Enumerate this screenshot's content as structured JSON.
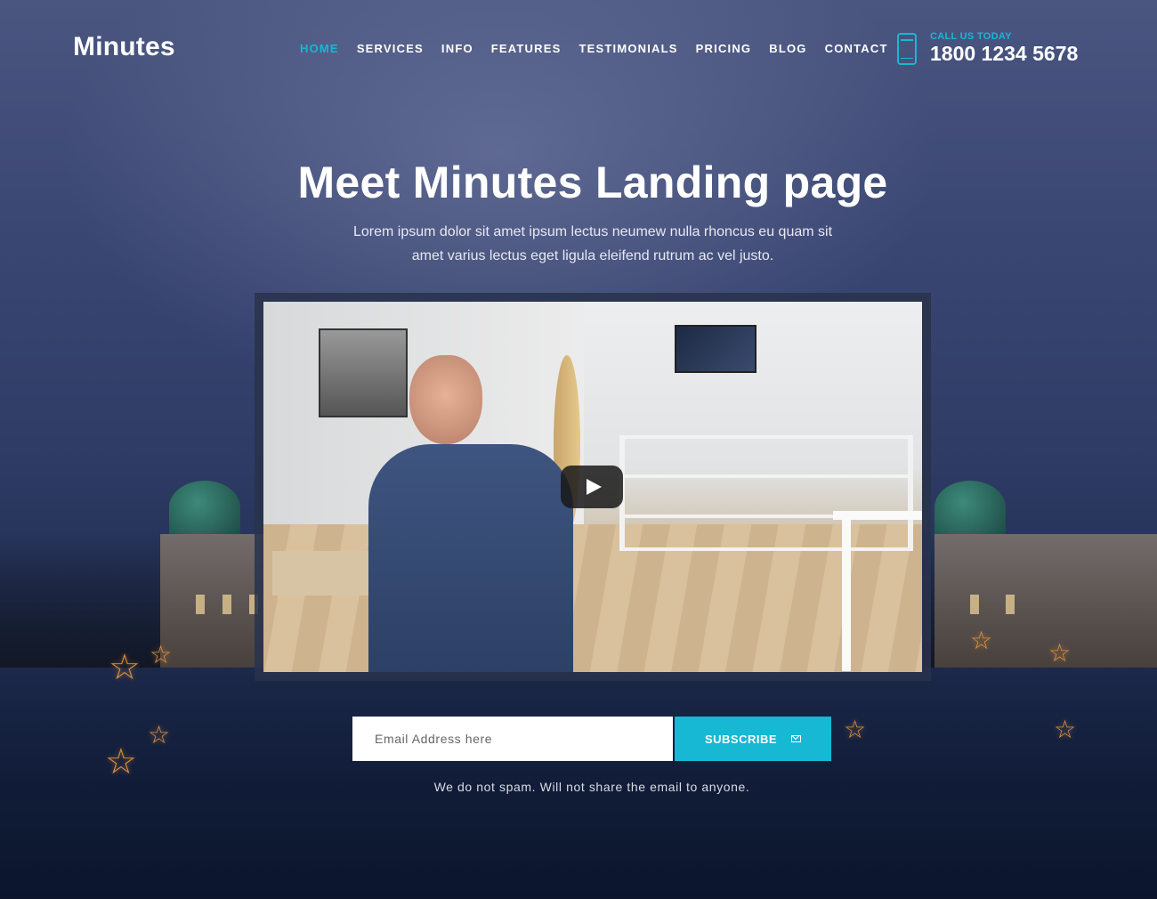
{
  "header": {
    "logo": "Minutes",
    "nav": [
      {
        "label": "HOME",
        "active": true
      },
      {
        "label": "SERVICES",
        "active": false
      },
      {
        "label": "INFO",
        "active": false
      },
      {
        "label": "FEATURES",
        "active": false
      },
      {
        "label": "TESTIMONIALS",
        "active": false
      },
      {
        "label": "PRICING",
        "active": false
      },
      {
        "label": "BLOG",
        "active": false
      },
      {
        "label": "CONTACT",
        "active": false
      }
    ],
    "call_label": "CALL US TODAY",
    "call_number": "1800 1234 5678"
  },
  "hero": {
    "title": "Meet Minutes Landing page",
    "subtitle": "Lorem ipsum dolor sit amet ipsum lectus neumew nulla rhoncus eu quam sit amet varius lectus eget ligula eleifend rutrum ac vel justo."
  },
  "video": {
    "play_icon": "play-icon"
  },
  "subscribe": {
    "placeholder": "Email Address here",
    "button_label": "SUBSCRIBE",
    "button_icon": "envelope-icon",
    "note": "We do not spam. Will not share the email to anyone."
  },
  "colors": {
    "accent": "#16b8d4",
    "text": "#ffffff",
    "background": "#2c3a5e"
  }
}
